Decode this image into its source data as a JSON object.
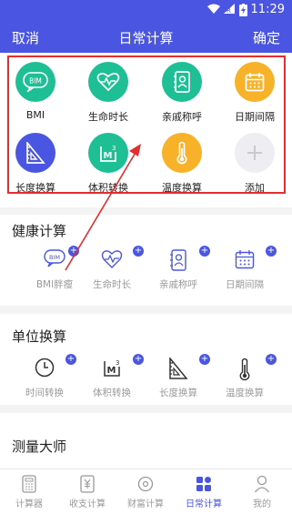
{
  "status": {
    "time": "11:29"
  },
  "header": {
    "cancel_label": "取消",
    "title": "日常计算",
    "confirm_label": "确定"
  },
  "favorites": {
    "items": [
      {
        "label": "BMI",
        "icon": "bmi-icon",
        "color": "#1fbf95"
      },
      {
        "label": "生命时长",
        "icon": "heart-pulse-icon",
        "color": "#1fbf95"
      },
      {
        "label": "亲戚称呼",
        "icon": "contacts-book-icon",
        "color": "#1fbf95"
      },
      {
        "label": "日期间隔",
        "icon": "calendar-icon",
        "color": "#f7b22a"
      },
      {
        "label": "长度换算",
        "icon": "ruler-triangle-icon",
        "color": "#4a56e2"
      },
      {
        "label": "体积转换",
        "icon": "cube-m3-icon",
        "color": "#1fbf95"
      },
      {
        "label": "温度换算",
        "icon": "thermometer-icon",
        "color": "#f7b22a"
      },
      {
        "label": "添加",
        "icon": "plus-icon",
        "color": "#eeeef2"
      }
    ]
  },
  "health": {
    "title": "健康计算",
    "items": [
      {
        "label": "BMI胖瘦",
        "icon": "bmi-icon"
      },
      {
        "label": "生命时长",
        "icon": "heart-pulse-icon"
      },
      {
        "label": "亲戚称呼",
        "icon": "contacts-book-icon"
      },
      {
        "label": "日期间隔",
        "icon": "calendar-icon"
      }
    ]
  },
  "units": {
    "title": "单位换算",
    "items": [
      {
        "label": "时间转换",
        "icon": "clock-icon"
      },
      {
        "label": "体积转换",
        "icon": "cube-m3-icon"
      },
      {
        "label": "长度换算",
        "icon": "ruler-triangle-icon"
      },
      {
        "label": "温度换算",
        "icon": "thermometer-icon"
      }
    ]
  },
  "measure": {
    "title": "测量大师"
  },
  "bottom_nav": {
    "items": [
      {
        "label": "计算器",
        "icon": "calculator-icon"
      },
      {
        "label": "收支计算",
        "icon": "yuan-receipt-icon"
      },
      {
        "label": "财富计算",
        "icon": "coin-icon"
      },
      {
        "label": "日常计算",
        "icon": "grid-icon",
        "active": true
      },
      {
        "label": "我的",
        "icon": "person-icon"
      }
    ]
  },
  "colors": {
    "brand": "#4a56e2",
    "teal": "#1fbf95",
    "orange": "#f7b22a",
    "highlight_box": "#e52d2d"
  }
}
